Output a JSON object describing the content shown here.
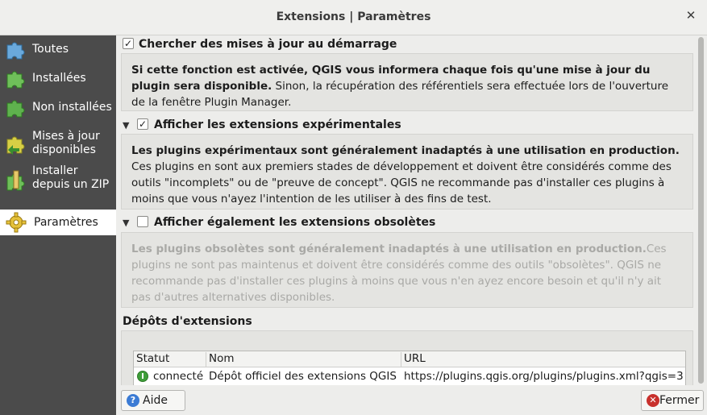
{
  "window": {
    "title": "Extensions | Paramètres"
  },
  "sidebar": {
    "items": [
      {
        "label": "Toutes",
        "icon": "puzzle-all-icon"
      },
      {
        "label": "Installées",
        "icon": "puzzle-installed-icon"
      },
      {
        "label": "Non installées",
        "icon": "puzzle-not-installed-icon"
      },
      {
        "label_line1": "Mises à jour",
        "label_line2": "disponibles",
        "icon": "puzzle-upgrade-icon"
      },
      {
        "label_line1": "Installer",
        "label_line2": "depuis un ZIP",
        "icon": "puzzle-zip-icon"
      },
      {
        "label": "Paramètres",
        "icon": "gear-icon",
        "active": true
      }
    ]
  },
  "settings": {
    "check_updates": {
      "label": "Chercher des mises à jour au démarrage",
      "checked": true,
      "desc_bold": "Si cette fonction est activée, QGIS vous informera chaque fois qu'une mise à jour du plugin sera disponible.",
      "desc_rest": " Sinon, la récupération des référentiels sera effectuée lors de l'ouverture de la fenêtre Plugin Manager."
    },
    "experimental": {
      "label": "Afficher les extensions expérimentales",
      "checked": true,
      "desc_bold": "Les plugins expérimentaux sont généralement inadaptés à une utilisation en production.",
      "desc_rest": " Ces plugins en sont aux premiers stades de développement et doivent être considérés comme des outils \"incomplets\" ou de \"preuve de concept\". QGIS ne recommande pas d'installer ces plugins à moins que vous n'ayez l'intention de les utiliser à des fins de test."
    },
    "deprecated": {
      "label": "Afficher également les extensions obsolètes",
      "checked": false,
      "desc_bold": "Les plugins obsolètes sont généralement inadaptés à une utilisation en production.",
      "desc_rest": "Ces plugins ne sont pas maintenus et doivent être considérés comme des outils \"obsolètes\". QGIS ne recommande pas d'installer ces plugins à moins que vous n'en ayez encore besoin et qu'il n'y ait pas d'autres alternatives disponibles."
    }
  },
  "repos": {
    "title": "Dépôts d'extensions",
    "columns": [
      "Statut",
      "Nom",
      "URL"
    ],
    "rows": [
      {
        "status": "connecté",
        "name": "Dépôt officiel des extensions QGIS",
        "url": "https://plugins.qgis.org/plugins/plugins.xml?qgis=3"
      }
    ]
  },
  "footer": {
    "help_label": "Aide",
    "close_label": "Fermer"
  },
  "colors": {
    "sidebar_bg": "#4b4b4b",
    "status_ok": "#3f9e3a",
    "close_icon": "#c8302c",
    "help_icon": "#3b7bd4"
  }
}
